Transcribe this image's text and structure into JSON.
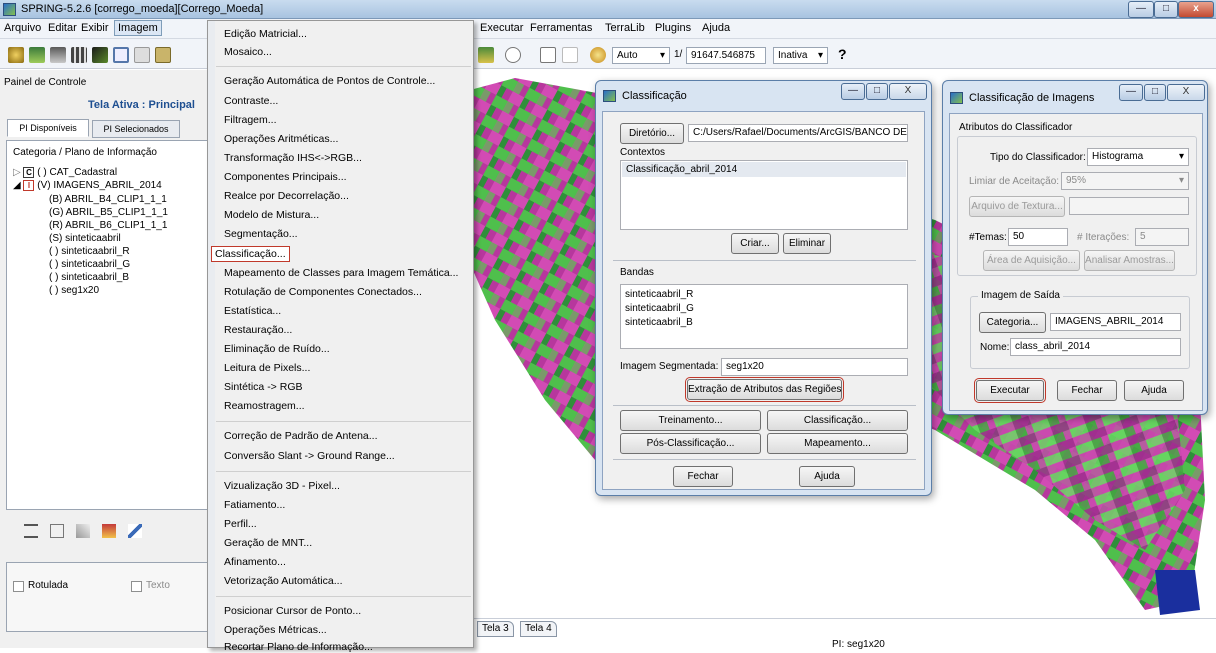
{
  "window": {
    "title": "SPRING-5.2.6 [corrego_moeda][Corrego_Moeda]",
    "controls": {
      "minimize": "—",
      "maximize": "□",
      "close": "x"
    }
  },
  "menubar": {
    "items": [
      "Arquivo",
      "Editar",
      "Exibir",
      "Imagem",
      "Executar",
      "Ferramentas",
      "TerraLib",
      "Plugins",
      "Ajuda"
    ]
  },
  "toolbar": {
    "auto_label": "Auto",
    "scale_prefix": "1/",
    "scale_value": "91647.546875",
    "inativa_label": "Inativa",
    "help_glyph": "?"
  },
  "left_panel": {
    "header": "Painel de Controle",
    "tela_ativa": "Tela Ativa : Principal",
    "tabs": [
      "PI Disponíveis",
      "PI Selecionados"
    ],
    "tree_header": "Categoria / Plano de Informação",
    "tree": [
      {
        "box": "C",
        "label": "( ) CAT_Cadastral",
        "level": 0
      },
      {
        "box": "I",
        "label": "(V) IMAGENS_ABRIL_2014",
        "level": 0
      },
      {
        "label": "(B) ABRIL_B4_CLIP1_1_1",
        "level": 1
      },
      {
        "label": "(G) ABRIL_B5_CLIP1_1_1",
        "level": 1
      },
      {
        "label": "(R) ABRIL_B6_CLIP1_1_1",
        "level": 1
      },
      {
        "label": "(S) sinteticaabril",
        "level": 1
      },
      {
        "label": "( ) sinteticaabril_R",
        "level": 1
      },
      {
        "label": "( ) sinteticaabril_G",
        "level": 1
      },
      {
        "label": "( ) sinteticaabril_B",
        "level": 1
      },
      {
        "label": "( ) seg1x20",
        "level": 1
      }
    ],
    "rotulada_label": "Rotulada",
    "texto_label": "Texto"
  },
  "image_menu": {
    "items": [
      "Edição Matricial...",
      "Mosaico...",
      "---",
      "Geração Automática de Pontos de Controle...",
      "Contraste...",
      "Filtragem...",
      "Operações Aritméticas...",
      "Transformação IHS<->RGB...",
      "Componentes Principais...",
      "Realce por Decorrelação...",
      "Modelo de Mistura...",
      "Segmentação...",
      "Classificação...",
      "Mapeamento de Classes para Imagem Temática...",
      "Rotulação de Componentes Conectados...",
      "Estatística...",
      "Restauração...",
      "Eliminação de Ruído...",
      "Leitura de Pixels...",
      "Sintética -> RGB",
      "Reamostragem...",
      "---",
      "Correção de Padrão de Antena...",
      "Conversão Slant -> Ground Range...",
      "---",
      "Vizualização 3D - Pixel...",
      "Fatiamento...",
      "Perfil...",
      "Geração de MNT...",
      "Afinamento...",
      "Vetorização Automática...",
      "---",
      "Posicionar Cursor de Ponto...",
      "Operações Métricas...",
      "Recortar Plano de Informação..."
    ],
    "highlighted": "Classificação..."
  },
  "classificacao_dialog": {
    "title": "Classificação",
    "diretorio_button": "Diretório...",
    "diretorio_path": "C:/Users/Rafael/Documents/ArcGIS/BANCO DE DA",
    "contextos_label": "Contextos",
    "contextos": [
      "Classificação_abril_2014"
    ],
    "criar_button": "Criar...",
    "eliminar_button": "Eliminar",
    "bandas_label": "Bandas",
    "bandas": [
      "sinteticaabril_R",
      "sinteticaabril_G",
      "sinteticaabril_B"
    ],
    "imagem_segmentada_label": "Imagem Segmentada:",
    "imagem_segmentada_value": "seg1x20",
    "extracao_button": "Extração de Atributos das Regiões",
    "treinamento_button": "Treinamento...",
    "classificacao_button": "Classificação...",
    "pos_button": "Pós-Classificação...",
    "mapeamento_button": "Mapeamento...",
    "fechar_button": "Fechar",
    "ajuda_button": "Ajuda"
  },
  "classif_imagens_dialog": {
    "title": "Classificação de Imagens",
    "atributos_label": "Atributos do Classificador",
    "tipo_label": "Tipo do Classificador:",
    "tipo_value": "Histograma",
    "limiar_label": "Limiar de Aceitação:",
    "limiar_value": "95%",
    "arquivo_textura_button": "Arquivo de Textura...",
    "temas_label": "#Temas:",
    "temas_value": "50",
    "iteracoes_label": "# Iterações:",
    "iteracoes_value": "5",
    "area_button": "Área de Aquisição...",
    "analisar_button": "Analisar Amostras...",
    "imagem_saida_label": "Imagem de Saída",
    "categoria_button": "Categoria...",
    "categoria_value": "IMAGENS_ABRIL_2014",
    "nome_label": "Nome:",
    "nome_value": "class_abril_2014",
    "executar_button": "Executar",
    "fechar_button": "Fechar",
    "ajuda_button": "Ajuda"
  },
  "bottom": {
    "tabs": [
      "Tela 3",
      "Tela 4"
    ],
    "status": "PI: seg1x20"
  },
  "colors": {
    "accent_blue": "#1e4f91",
    "highlight_red": "#c0392b",
    "image_magenta": "#c43aa6",
    "image_green": "#5dd15a"
  }
}
